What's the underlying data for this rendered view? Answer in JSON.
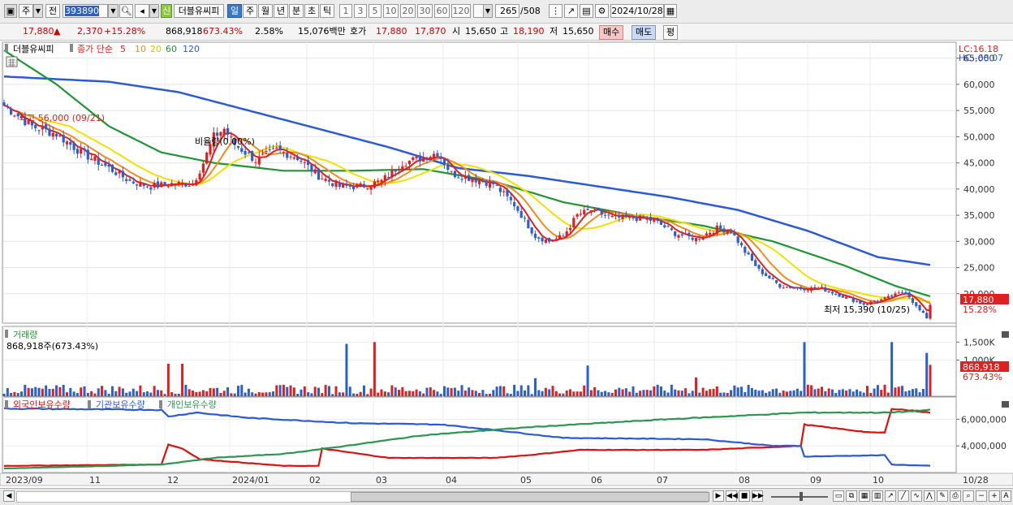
{
  "toolbar": {
    "market": "주",
    "mode": "전",
    "code": "393890",
    "badge": "신",
    "name": "더블유씨피",
    "periods": [
      "일",
      "주",
      "월",
      "년",
      "분",
      "초",
      "틱"
    ],
    "active_period": "일",
    "intervals": [
      "1",
      "3",
      "5",
      "10",
      "20",
      "30",
      "60",
      "120"
    ],
    "count": "265",
    "count_total": "/508",
    "date": "2024/10/28"
  },
  "quote": {
    "price": "17,880",
    "change_arrow": "▲",
    "change": "2,370",
    "change_pct": "+15.28%",
    "volume": "868,918",
    "volume_ratio": "673.43%",
    "turnover": "2.58%",
    "amount": "15,076백만",
    "ask_label": "호가",
    "ask": "17,880",
    "bid": "17,870",
    "open_label": "시",
    "open": "15,650",
    "high_label": "고",
    "high": "18,190",
    "low_label": "저",
    "low": "15,650",
    "buy_label": "매수",
    "sell_label": "매도",
    "eval_label": "평"
  },
  "price_panel": {
    "name_tag": "더블유씨피",
    "legend_title": "종가 단순",
    "ma_labels": [
      "5",
      "10",
      "20",
      "60",
      "120"
    ],
    "lc": "LC:16.18",
    "hc": "HC:-68.07",
    "high_note": "최고 56,000 (09/21)",
    "low_note": "최저 15,390 (10/25)",
    "annotation": "비율량(0.00%)",
    "last_price": "17,880",
    "last_pct": "15.28%"
  },
  "volume_panel": {
    "title": "거래량",
    "subtitle": "868,918주(673.43%)",
    "last": "868,918",
    "last_pct": "673.43%"
  },
  "holdings_panel": {
    "legend": [
      "외국인보유수량",
      "기관보유수량",
      "개인보유수량"
    ]
  },
  "colors": {
    "up": "#e02020",
    "down": "#2a5fd0",
    "ma5": "#e02020",
    "ma10": "#f08c1e",
    "ma20": "#f2e000",
    "ma60": "#1e9632",
    "ma120": "#2a5ad8",
    "foreign": "#e01010",
    "institution": "#2a5ad8",
    "individual": "#2a9650"
  },
  "chart_data": [
    {
      "type": "candlestick",
      "y_ticks": [
        20000,
        25000,
        30000,
        35000,
        40000,
        45000,
        50000,
        55000,
        60000,
        65000
      ],
      "ylim": [
        15000,
        66500
      ],
      "x_ticks": [
        "2023/09",
        "11",
        "12",
        "2024/01",
        "02",
        "03",
        "04",
        "05",
        "06",
        "07",
        "08",
        "09",
        "10",
        "10/28"
      ],
      "close_anchors": [
        [
          0,
          56000
        ],
        [
          8,
          52000
        ],
        [
          15,
          50500
        ],
        [
          22,
          47000
        ],
        [
          30,
          44000
        ],
        [
          36,
          41500
        ],
        [
          42,
          40500
        ],
        [
          48,
          41000
        ],
        [
          54,
          41000
        ],
        [
          57,
          45000
        ],
        [
          60,
          50000
        ],
        [
          63,
          51500
        ],
        [
          66,
          48500
        ],
        [
          72,
          45500
        ],
        [
          78,
          47500
        ],
        [
          84,
          46000
        ],
        [
          90,
          42500
        ],
        [
          96,
          40500
        ],
        [
          102,
          40500
        ],
        [
          108,
          41500
        ],
        [
          114,
          45000
        ],
        [
          120,
          46000
        ],
        [
          124,
          47000
        ],
        [
          128,
          43000
        ],
        [
          134,
          42000
        ],
        [
          140,
          41000
        ],
        [
          146,
          37000
        ],
        [
          152,
          31000
        ],
        [
          156,
          30000
        ],
        [
          160,
          31000
        ],
        [
          164,
          35000
        ],
        [
          168,
          36000
        ],
        [
          174,
          34500
        ],
        [
          180,
          34500
        ],
        [
          186,
          34000
        ],
        [
          192,
          31500
        ],
        [
          198,
          30500
        ],
        [
          204,
          32500
        ],
        [
          208,
          32000
        ],
        [
          212,
          28000
        ],
        [
          216,
          24500
        ],
        [
          222,
          21500
        ],
        [
          228,
          21000
        ],
        [
          234,
          21000
        ],
        [
          240,
          19500
        ],
        [
          246,
          18000
        ],
        [
          252,
          19000
        ],
        [
          258,
          20500
        ],
        [
          261,
          17500
        ],
        [
          264,
          15390
        ],
        [
          265,
          17880
        ]
      ],
      "ma60_anchors": [
        [
          0,
          66500
        ],
        [
          15,
          60000
        ],
        [
          30,
          52000
        ],
        [
          45,
          47000
        ],
        [
          60,
          45000
        ],
        [
          80,
          43500
        ],
        [
          100,
          43500
        ],
        [
          120,
          43800
        ],
        [
          140,
          41500
        ],
        [
          160,
          37500
        ],
        [
          180,
          35000
        ],
        [
          200,
          33000
        ],
        [
          220,
          30000
        ],
        [
          240,
          25500
        ],
        [
          255,
          21500
        ],
        [
          265,
          19500
        ]
      ],
      "ma120_anchors": [
        [
          0,
          61500
        ],
        [
          30,
          60500
        ],
        [
          50,
          58500
        ],
        [
          70,
          55000
        ],
        [
          90,
          51500
        ],
        [
          110,
          48000
        ],
        [
          130,
          44000
        ],
        [
          150,
          42500
        ],
        [
          170,
          40500
        ],
        [
          190,
          38500
        ],
        [
          210,
          36000
        ],
        [
          230,
          32000
        ],
        [
          250,
          27000
        ],
        [
          265,
          25500
        ]
      ]
    },
    {
      "type": "bar",
      "y_ticks": [
        1000000,
        1500000
      ],
      "tick_labels": [
        "1,000K",
        "1,500K"
      ],
      "ylim": [
        0,
        1800000
      ],
      "spikes": [
        [
          47,
          900000
        ],
        [
          51,
          900000
        ],
        [
          98,
          1450000
        ],
        [
          106,
          1500000
        ],
        [
          152,
          500000
        ],
        [
          167,
          850000
        ],
        [
          198,
          520000
        ],
        [
          229,
          1500000
        ],
        [
          254,
          1500000
        ],
        [
          264,
          1200000
        ],
        [
          265,
          868918
        ]
      ]
    },
    {
      "type": "line",
      "y_ticks": [
        4000000,
        6000000
      ],
      "tick_labels": [
        "4,000,000",
        "6,000,000"
      ],
      "ylim": [
        2000000,
        7300000
      ],
      "series": [
        {
          "name": "외국인보유수량",
          "anchors": [
            [
              0,
              2500000
            ],
            [
              45,
              2600000
            ],
            [
              47,
              4100000
            ],
            [
              51,
              3800000
            ],
            [
              56,
              3000000
            ],
            [
              80,
              2500000
            ],
            [
              90,
              2500000
            ],
            [
              91,
              3800000
            ],
            [
              110,
              3100000
            ],
            [
              140,
              3100000
            ],
            [
              150,
              3300000
            ],
            [
              165,
              3700000
            ],
            [
              200,
              3700000
            ],
            [
              228,
              4000000
            ],
            [
              229,
              5600000
            ],
            [
              248,
              5000000
            ],
            [
              252,
              5000000
            ],
            [
              254,
              6800000
            ],
            [
              265,
              6500000
            ]
          ]
        },
        {
          "name": "기관보유수량",
          "anchors": [
            [
              0,
              6800000
            ],
            [
              45,
              6700000
            ],
            [
              47,
              6200000
            ],
            [
              55,
              6500000
            ],
            [
              70,
              6100000
            ],
            [
              100,
              5700000
            ],
            [
              125,
              5600000
            ],
            [
              140,
              5200000
            ],
            [
              160,
              4600000
            ],
            [
              200,
              4500000
            ],
            [
              220,
              4000000
            ],
            [
              228,
              4000000
            ],
            [
              229,
              3200000
            ],
            [
              252,
              3300000
            ],
            [
              254,
              2600000
            ],
            [
              265,
              2500000
            ]
          ]
        },
        {
          "name": "개인보유수량",
          "anchors": [
            [
              0,
              2300000
            ],
            [
              45,
              2600000
            ],
            [
              60,
              3100000
            ],
            [
              80,
              3400000
            ],
            [
              95,
              3900000
            ],
            [
              120,
              4800000
            ],
            [
              150,
              5400000
            ],
            [
              190,
              6000000
            ],
            [
              229,
              6500000
            ],
            [
              254,
              6500000
            ],
            [
              265,
              6700000
            ]
          ]
        }
      ]
    }
  ]
}
